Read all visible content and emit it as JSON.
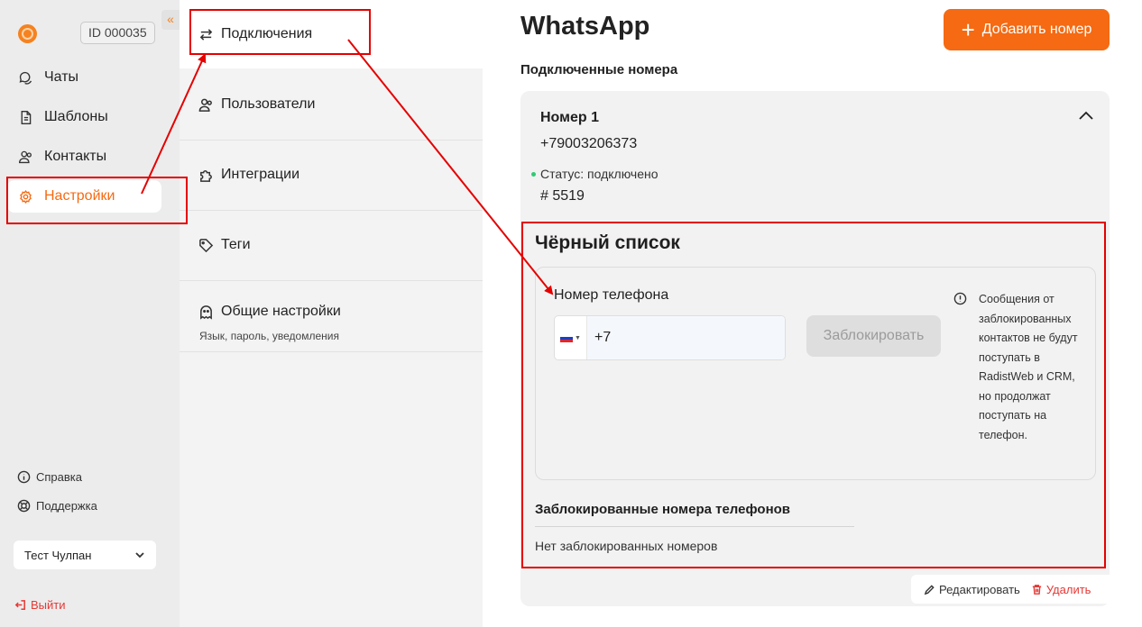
{
  "sidebar": {
    "account_id": "ID 000035",
    "collapse_glyph": "«",
    "nav": [
      {
        "label": "Чаты",
        "icon": "chat-icon"
      },
      {
        "label": "Шаблоны",
        "icon": "document-icon"
      },
      {
        "label": "Контакты",
        "icon": "contacts-icon"
      },
      {
        "label": "Настройки",
        "icon": "gear-icon",
        "active": true
      }
    ],
    "help_label": "Справка",
    "support_label": "Поддержка",
    "user_name": "Тест Чулпан",
    "logout_label": "Выйти"
  },
  "settings_menu": {
    "items": [
      {
        "label": "Подключения",
        "icon": "swap-arrows-icon"
      },
      {
        "label": "Пользователи",
        "icon": "users-icon"
      },
      {
        "label": "Интеграции",
        "icon": "puzzle-icon"
      },
      {
        "label": "Теги",
        "icon": "tag-icon"
      },
      {
        "label": "Общие настройки",
        "icon": "ghost-icon",
        "description": "Язык, пароль, уведомления"
      }
    ]
  },
  "main": {
    "title": "WhatsApp",
    "add_button_label": "Добавить номер",
    "connected_label": "Подключенные номера",
    "number_card": {
      "name": "Номер 1",
      "phone": "+79003206373",
      "status": "Статус: подключено",
      "code": "# 5519"
    },
    "blacklist": {
      "title": "Чёрный список",
      "field_label": "Номер телефона",
      "phone_value": "+7",
      "block_button_label": "Заблокировать",
      "info_text": "Сообщения от заблокированных контактов не будут поступать в RadistWeb и CRM, но продолжат поступать на телефон.",
      "blocked_title": "Заблокированные номера телефонов",
      "blocked_empty": "Нет заблокированных номеров"
    },
    "edit_label": "Редактировать",
    "delete_label": "Удалить"
  },
  "colors": {
    "accent": "#f56a12",
    "annotation": "#e50000",
    "status_ok": "#2ecc71",
    "danger": "#e53935"
  }
}
